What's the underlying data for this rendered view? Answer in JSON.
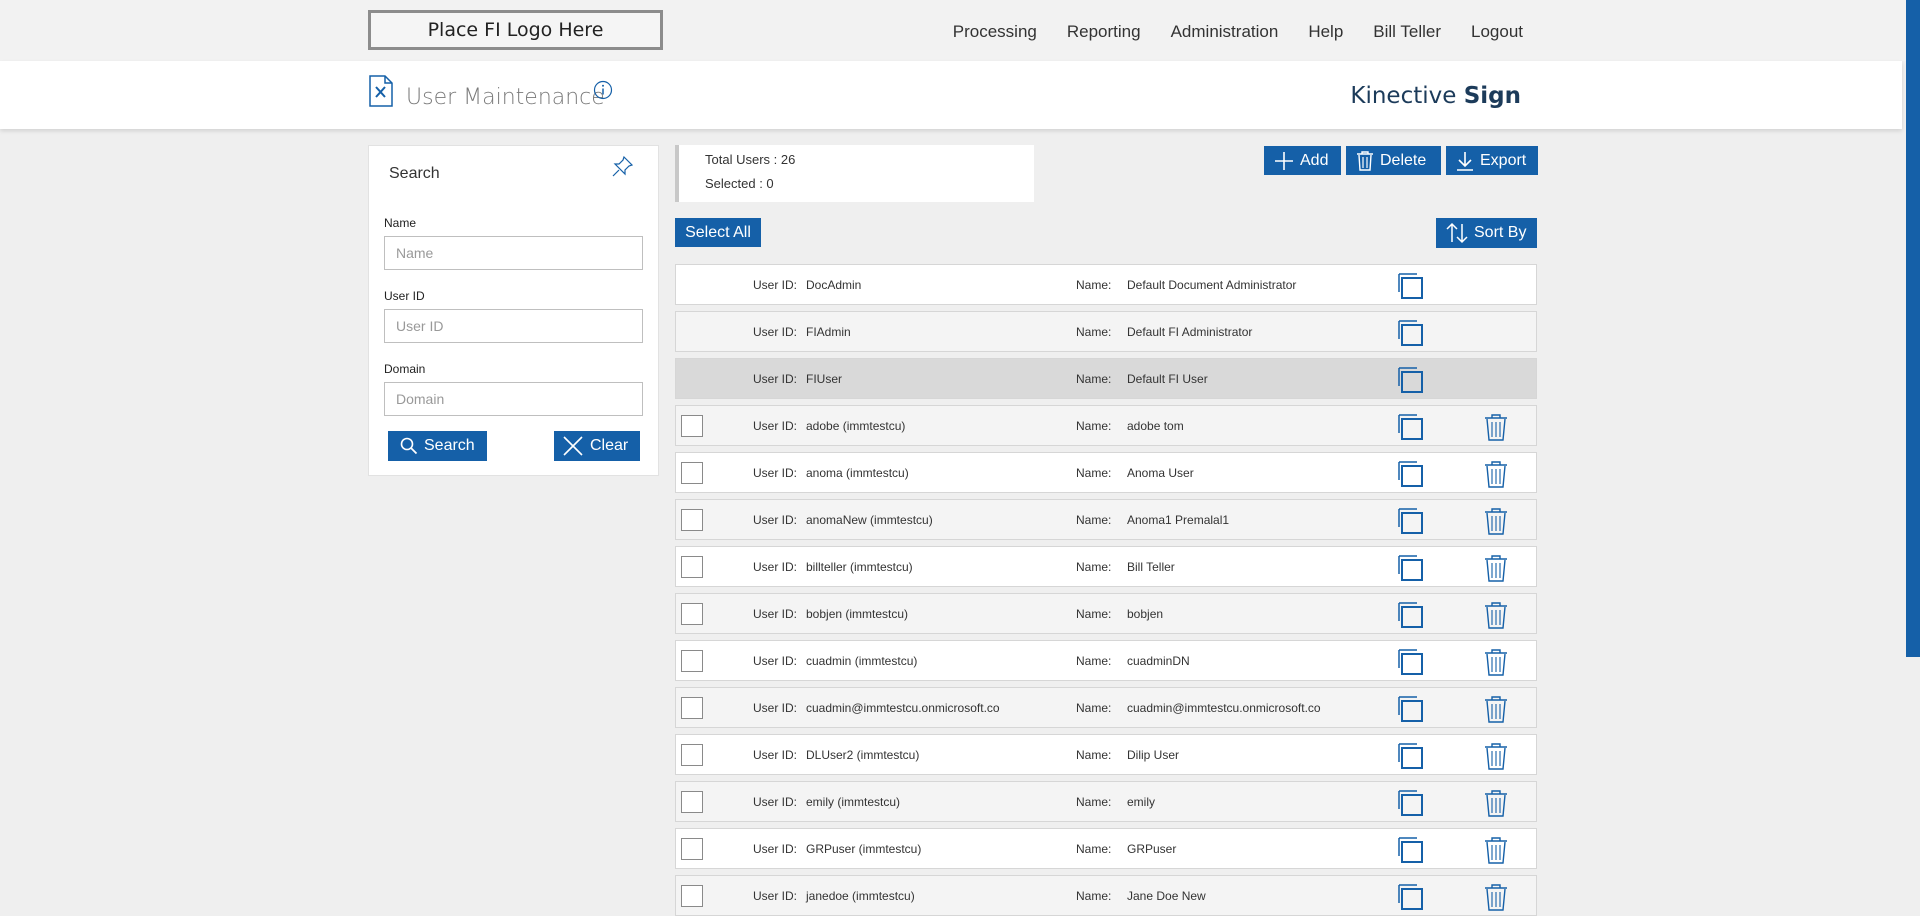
{
  "topbar": {
    "logo_text": "Place FI Logo Here",
    "nav": [
      "Processing",
      "Reporting",
      "Administration",
      "Help",
      "Bill Teller",
      "Logout"
    ]
  },
  "header": {
    "title": "User Maintenance",
    "brand_light": "Kinective ",
    "brand_bold": "Sign"
  },
  "search": {
    "title": "Search",
    "name_label": "Name",
    "name_placeholder": "Name",
    "userid_label": "User ID",
    "userid_placeholder": "User ID",
    "domain_label": "Domain",
    "domain_placeholder": "Domain",
    "search_button": "Search",
    "clear_button": "Clear"
  },
  "summary": {
    "total_users": "Total Users : 26",
    "selected": "Selected : 0"
  },
  "toolbar": {
    "add": "Add",
    "delete": "Delete",
    "export": "Export",
    "select_all": "Select All",
    "sort_by": "Sort By"
  },
  "row_labels": {
    "user_id": "User ID:",
    "name": "Name:"
  },
  "users": [
    {
      "user_id": "DocAdmin",
      "name": "Default Document Administrator",
      "system": true,
      "selected": false
    },
    {
      "user_id": "FIAdmin",
      "name": "Default FI Administrator",
      "system": true,
      "selected": false
    },
    {
      "user_id": "FIUser",
      "name": "Default FI User",
      "system": true,
      "selected": true
    },
    {
      "user_id": "adobe (immtestcu)",
      "name": "adobe tom",
      "system": false,
      "selected": false
    },
    {
      "user_id": "anoma (immtestcu)",
      "name": "Anoma User",
      "system": false,
      "selected": false
    },
    {
      "user_id": "anomaNew (immtestcu)",
      "name": "Anoma1 Premalal1",
      "system": false,
      "selected": false
    },
    {
      "user_id": "billteller (immtestcu)",
      "name": "Bill Teller",
      "system": false,
      "selected": false
    },
    {
      "user_id": "bobjen (immtestcu)",
      "name": "bobjen",
      "system": false,
      "selected": false
    },
    {
      "user_id": "cuadmin (immtestcu)",
      "name": "cuadminDN",
      "system": false,
      "selected": false
    },
    {
      "user_id": "cuadmin@immtestcu.onmicrosoft.co",
      "name": "cuadmin@immtestcu.onmicrosoft.co",
      "system": false,
      "selected": false
    },
    {
      "user_id": "DLUser2 (immtestcu)",
      "name": "Dilip User",
      "system": false,
      "selected": false
    },
    {
      "user_id": "emily (immtestcu)",
      "name": "emily",
      "system": false,
      "selected": false
    },
    {
      "user_id": "GRPuser (immtestcu)",
      "name": "GRPuser",
      "system": false,
      "selected": false
    },
    {
      "user_id": "janedoe (immtestcu)",
      "name": "Jane Doe New",
      "system": false,
      "selected": false
    }
  ],
  "colors": {
    "accent": "#1560a8",
    "brand": "#1c3b5a"
  }
}
